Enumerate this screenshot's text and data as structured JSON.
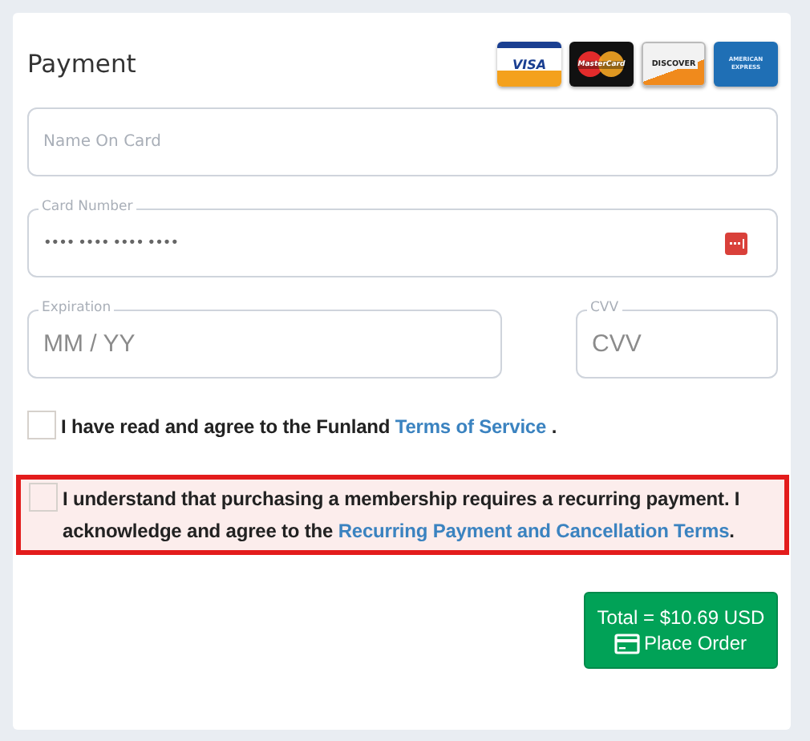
{
  "title": "Payment",
  "cards": [
    {
      "kind": "visa",
      "label": "VISA"
    },
    {
      "kind": "mastercard",
      "label": "MasterCard"
    },
    {
      "kind": "discover",
      "label": "DISCOVER"
    },
    {
      "kind": "amex",
      "label": "AMERICAN EXPRESS"
    }
  ],
  "fields": [
    {
      "kind": "name",
      "placeholder": "Name On Card"
    },
    {
      "kind": "number",
      "label": "Card Number",
      "value": "•••• •••• •••• ••••"
    },
    {
      "kind": "expiration",
      "label": "Expiration",
      "placeholder": "MM / YY"
    },
    {
      "kind": "cvv",
      "label": "CVV",
      "placeholder": "CVV"
    }
  ],
  "agreements": [
    {
      "checked": false,
      "error": false,
      "before": "I have read and agree to the Funland ",
      "link": "Terms of Service",
      "after": " ."
    },
    {
      "checked": false,
      "error": true,
      "before": "I understand that purchasing a membership requires a recurring payment. I acknowledge and agree to the ",
      "link": "Recurring Payment and Cancellation Terms",
      "after": "."
    }
  ],
  "order_button": {
    "total": "Total = $10.69 USD",
    "label": "Place Order"
  }
}
